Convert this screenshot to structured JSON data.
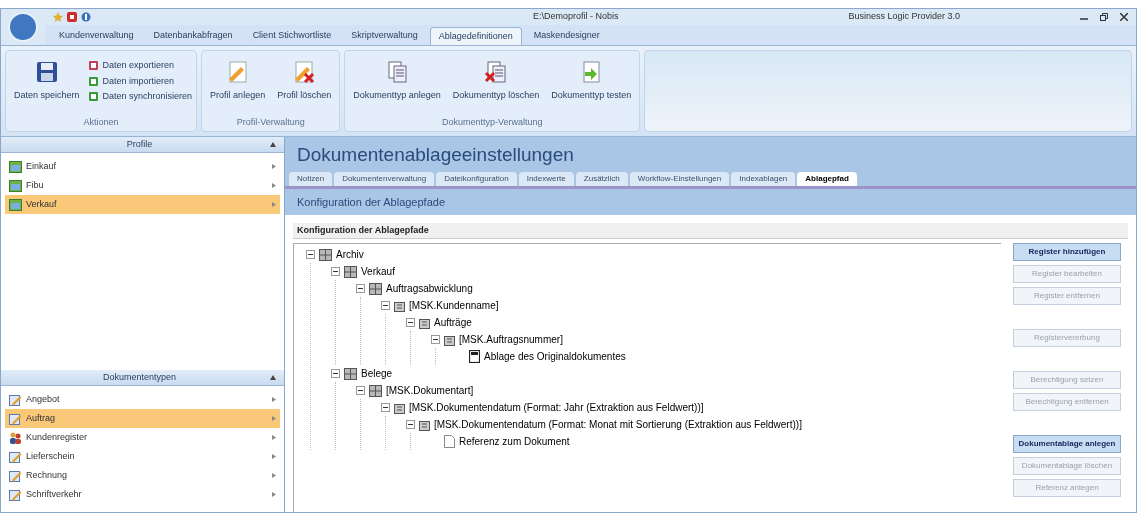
{
  "window": {
    "title": "E:\\Demoprofil - Nobis",
    "app_title": "Business Logic Provider 3.0"
  },
  "ribbon_tabs": [
    {
      "label": "Kundenverwaltung",
      "selected": false
    },
    {
      "label": "Datenbankabfragen",
      "selected": false
    },
    {
      "label": "Client Stichwortliste",
      "selected": false
    },
    {
      "label": "Skriptverwaltung",
      "selected": false
    },
    {
      "label": "Ablagedefinitionen",
      "selected": true
    },
    {
      "label": "Maskendesigner",
      "selected": false
    }
  ],
  "ribbon_groups": [
    {
      "label": "Aktionen",
      "large": [
        {
          "label": "Daten speichern"
        }
      ],
      "small": [
        {
          "label": "Daten exportieren"
        },
        {
          "label": "Daten importieren"
        },
        {
          "label": "Daten synchronisieren"
        }
      ]
    },
    {
      "label": "Profil-Verwaltung",
      "large": [
        {
          "label": "Profil anlegen"
        },
        {
          "label": "Profil löschen"
        }
      ]
    },
    {
      "label": "Dokumenttyp-Verwaltung",
      "large": [
        {
          "label": "Dokumenttyp anlegen"
        },
        {
          "label": "Dokumenttyp löschen"
        },
        {
          "label": "Dokumenttyp testen"
        }
      ]
    }
  ],
  "sidebar": {
    "sections": [
      {
        "title": "Profile",
        "items": [
          {
            "label": "Einkauf",
            "kind": "profile",
            "selected": false
          },
          {
            "label": "Fibu",
            "kind": "profile",
            "selected": false
          },
          {
            "label": "Verkauf",
            "kind": "profile",
            "selected": true
          }
        ]
      },
      {
        "title": "Dokumententypen",
        "items": [
          {
            "label": "Angebot",
            "kind": "document",
            "selected": false
          },
          {
            "label": "Auftrag",
            "kind": "document",
            "selected": true
          },
          {
            "label": "Kundenregister",
            "kind": "people",
            "selected": false
          },
          {
            "label": "Lieferschein",
            "kind": "document",
            "selected": false
          },
          {
            "label": "Rechnung",
            "kind": "document",
            "selected": false
          },
          {
            "label": "Schriftverkehr",
            "kind": "document",
            "selected": false
          }
        ]
      }
    ]
  },
  "page": {
    "title": "Dokumentenablageeinstellungen",
    "tabs": [
      {
        "label": "Notizen",
        "selected": false
      },
      {
        "label": "Dokumentenverwaltung",
        "selected": false
      },
      {
        "label": "Dateikonfiguration",
        "selected": false
      },
      {
        "label": "Indexwerte",
        "selected": false
      },
      {
        "label": "Zusätzlich",
        "selected": false
      },
      {
        "label": "Workflow-Einstellungen",
        "selected": false
      },
      {
        "label": "Indexablagen",
        "selected": false
      },
      {
        "label": "Ablagepfad",
        "selected": true
      }
    ],
    "subtitle": "Konfiguration der Ablagepfade",
    "section_title": "Konfiguration der Ablagepfade",
    "tree": [
      {
        "label": "Archiv",
        "kind": "cabinet",
        "expanded": true,
        "children": [
          {
            "label": "Verkauf",
            "kind": "cabinet",
            "expanded": true,
            "children": [
              {
                "label": "Auftragsabwicklung",
                "kind": "cabinet",
                "expanded": true,
                "children": [
                  {
                    "label": "[MSK.Kundenname]",
                    "kind": "register",
                    "expanded": true,
                    "children": [
                      {
                        "label": "Aufträge",
                        "kind": "register",
                        "expanded": true,
                        "children": [
                          {
                            "label": "[MSK.Auftragsnummer]",
                            "kind": "register",
                            "expanded": true,
                            "children": [
                              {
                                "label": "Ablage des Originaldokumentes",
                                "kind": "storage"
                              }
                            ]
                          }
                        ]
                      }
                    ]
                  }
                ]
              }
            ]
          },
          {
            "label": "Belege",
            "kind": "cabinet",
            "expanded": true,
            "children": [
              {
                "label": "[MSK.Dokumentart]",
                "kind": "cabinet",
                "expanded": true,
                "children": [
                  {
                    "label": "[MSK.Dokumentendatum (Format: Jahr (Extraktion aus Feldwert))]",
                    "kind": "register",
                    "expanded": true,
                    "children": [
                      {
                        "label": "[MSK.Dokumentendatum (Format: Monat mit Sortierung (Extraktion aus Feldwert))]",
                        "kind": "register",
                        "expanded": true,
                        "children": [
                          {
                            "label": "Referenz zum Dokument",
                            "kind": "reference"
                          }
                        ]
                      }
                    ]
                  }
                ]
              }
            ]
          }
        ]
      }
    ],
    "buttons": [
      {
        "label": "Register hinzufügen",
        "disabled": false,
        "kind": "button"
      },
      {
        "label": "Register bearbeiten",
        "disabled": true,
        "kind": "button"
      },
      {
        "label": "Register entfernen",
        "disabled": true,
        "kind": "button"
      },
      {
        "kind": "gap"
      },
      {
        "label": "Registervererbung",
        "disabled": true,
        "kind": "button"
      },
      {
        "kind": "gap"
      },
      {
        "label": "Berechtigung setzen",
        "disabled": true,
        "kind": "button"
      },
      {
        "label": "Berechtigung entfernen",
        "disabled": true,
        "kind": "button"
      },
      {
        "kind": "gap"
      },
      {
        "label": "Dokumentablage anlegen",
        "disabled": false,
        "kind": "button"
      },
      {
        "label": "Dokumentablage löschen",
        "disabled": true,
        "kind": "button"
      },
      {
        "label": "Referenz anlegen",
        "disabled": true,
        "kind": "button"
      }
    ]
  }
}
